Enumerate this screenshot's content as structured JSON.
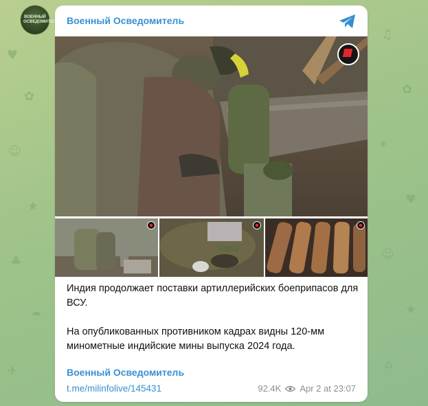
{
  "channel": {
    "name": "Военный Осведомитель",
    "avatar_text": "ВОЕННЫЙ ОСВЕДОМИТЕЛЬ"
  },
  "post": {
    "paragraph1": "Индия продолжает поставки артиллерийских боеприпасов для ВСУ.",
    "paragraph2": "На опубликованных противником кадрах видны 120-мм минометные индийские мины выпуска 2024 года.",
    "signature": "Военный Осведомитель",
    "link": "t.me/milinfolive/145431",
    "views": "92.4K",
    "timestamp": "Apr 2 at 23:07",
    "media_icons": [
      "ntv-logo-icon"
    ]
  },
  "colors": {
    "accent": "#3a8fd0",
    "background": "#a9c98e"
  }
}
